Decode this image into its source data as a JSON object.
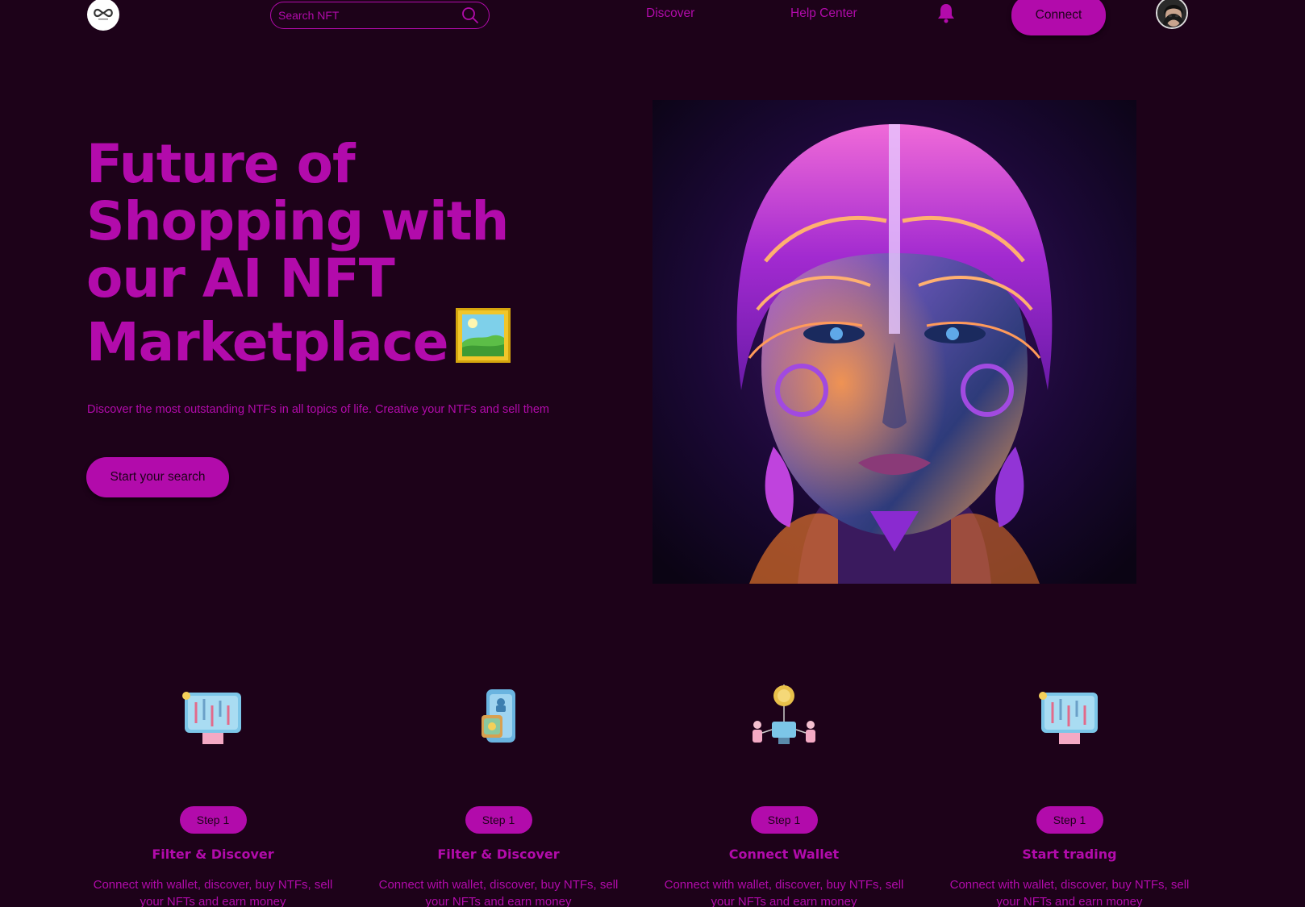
{
  "nav": {
    "search_placeholder": "Search NFT",
    "links": [
      "Discover",
      "Help Center"
    ],
    "connect_label": "Connect",
    "icons": {
      "logo": "infinity-logo-icon",
      "search": "search-icon",
      "bell": "bell-icon",
      "avatar": "avatar-icon"
    }
  },
  "hero": {
    "title_lines": [
      "Future of",
      "Shopping with",
      "our AI NFT",
      "Marketplace"
    ],
    "subtitle": "Discover the most outstanding NTFs in all topics of life. Creative your NTFs and sell them",
    "cta_label": "Start your search",
    "frame_icon": "framed-picture-icon"
  },
  "steps": [
    {
      "badge": "Step 1",
      "title": "Filter & Discover",
      "desc": "Connect with wallet, discover, buy NTFs, sell your NFTs and earn money",
      "icon": "chart-monitor-icon"
    },
    {
      "badge": "Step 1",
      "title": "Filter & Discover",
      "desc": "Connect with wallet, discover, buy NTFs, sell your NFTs and earn money",
      "icon": "wallet-phone-icon"
    },
    {
      "badge": "Step 1",
      "title": "Connect Wallet",
      "desc": "Connect with wallet, discover, buy NTFs, sell your NFTs and earn money",
      "icon": "crypto-network-icon"
    },
    {
      "badge": "Step 1",
      "title": "Start trading",
      "desc": "Connect with wallet, discover, buy NTFs, sell your NFTs and earn money",
      "icon": "chart-monitor-icon"
    }
  ],
  "colors": {
    "background": "#1d0219",
    "accent": "#b20bab"
  }
}
